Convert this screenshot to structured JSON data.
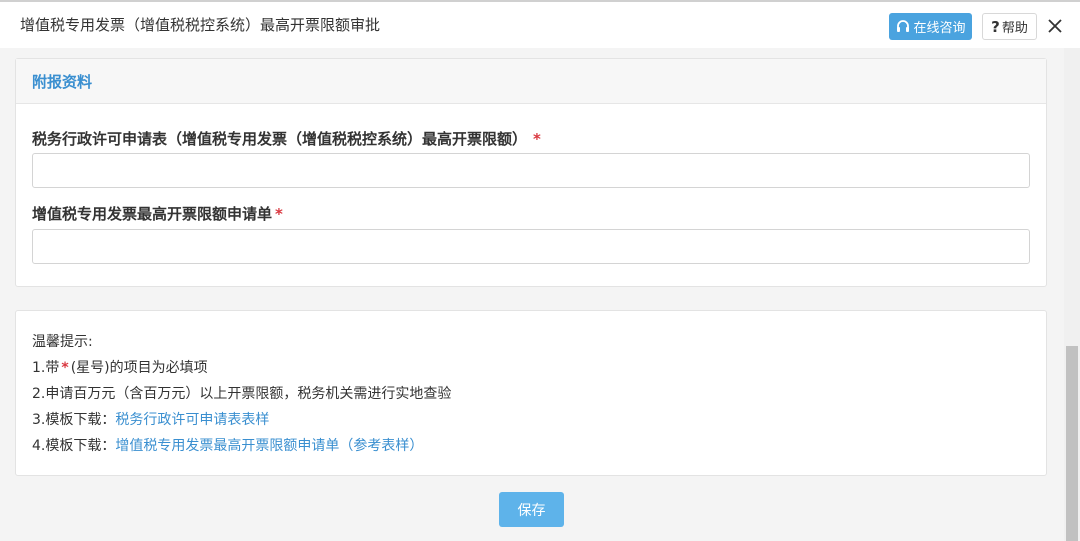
{
  "header": {
    "title": "增值税专用发票（增值税税控系统）最高开票限额审批",
    "consult_label": "在线咨询",
    "help_label": "帮助",
    "close_symbol": "✕"
  },
  "attachments": {
    "title": "附报资料",
    "fields": [
      {
        "label": "税务行政许可申请表（增值税专用发票（增值税税控系统）最高开票限额）",
        "required_mark": "*",
        "value": ""
      },
      {
        "label": "增值税专用发票最高开票限额申请单",
        "required_mark": "*",
        "value": ""
      }
    ]
  },
  "tips": {
    "title": "温馨提示:",
    "line1_prefix": "1.带",
    "line1_star": "*",
    "line1_suffix": "(星号)的项目为必填项",
    "line2": "2.申请百万元（含百万元）以上开票限额，税务机关需进行实地查验",
    "line3_prefix": "3.模板下载：",
    "line3_link": "税务行政许可申请表表样",
    "line4_prefix": "4.模板下载：",
    "line4_link": "增值税专用发票最高开票限额申请单（参考表样）"
  },
  "actions": {
    "save_label": "保存"
  },
  "colors": {
    "accent": "#4aa3df",
    "link": "#3a8fd0",
    "required": "#d9363e",
    "save_button": "#5eb3ea"
  },
  "icons": {
    "consult": "headset-icon",
    "help": "question-mark-icon",
    "close": "close-icon"
  }
}
